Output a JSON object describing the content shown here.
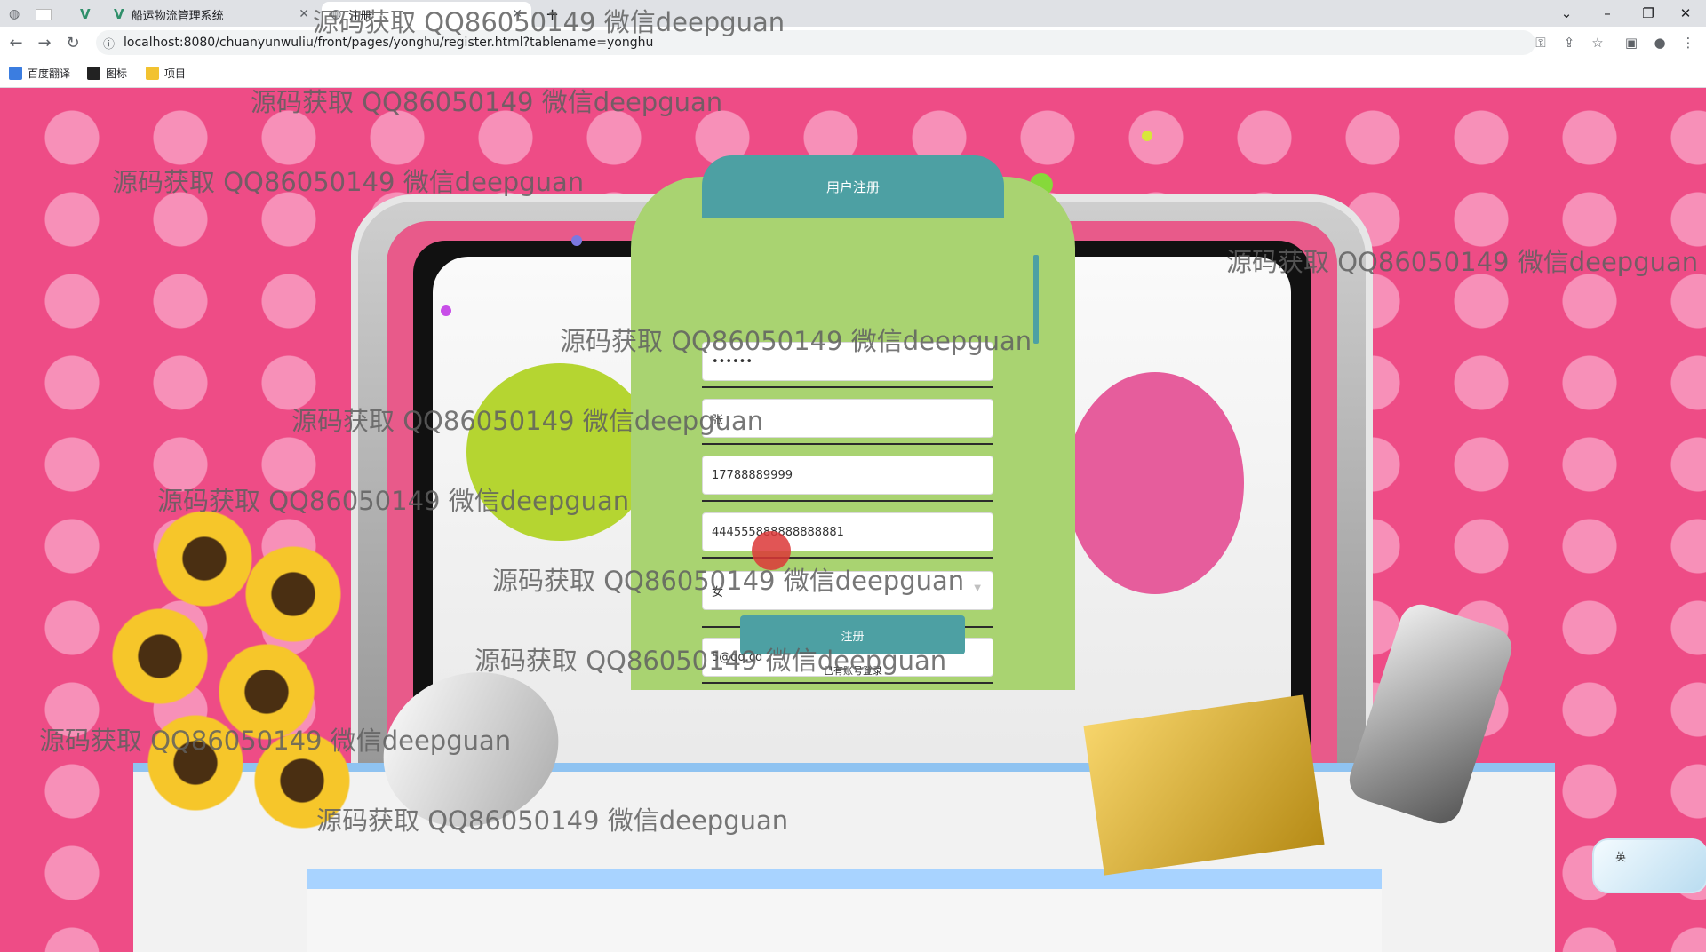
{
  "browser": {
    "tabs": [
      {
        "title": ""
      },
      {
        "title": ""
      },
      {
        "title": ""
      },
      {
        "title": "船运物流管理系统"
      },
      {
        "title": "注册"
      }
    ],
    "new_tab": "+",
    "window_controls": {
      "list": "⌄",
      "minimize": "–",
      "restore": "❐",
      "close": "✕"
    },
    "nav": {
      "back": "←",
      "forward": "→",
      "reload": "↻"
    },
    "address": {
      "info": "ⓘ",
      "url": "localhost:8080/chuanyunwuliu/front/pages/yonghu/register.html?tablename=yonghu"
    },
    "toolbar_icons": {
      "key": "⚿",
      "share": "⇪",
      "star": "☆",
      "sidebar": "▣",
      "profile": "●",
      "menu": "⋮"
    },
    "bookmarks": [
      {
        "label": "百度翻译",
        "color": "#3b7de0"
      },
      {
        "label": "图标",
        "color": "#222222"
      },
      {
        "label": "项目",
        "color": "#f2c230"
      }
    ]
  },
  "register": {
    "title": "用户注册",
    "fields": [
      {
        "name": "password",
        "value": "••••••"
      },
      {
        "name": "name",
        "value": "张"
      },
      {
        "name": "phone",
        "value": "17788889999"
      },
      {
        "name": "id_card",
        "value": "444555888888888881"
      },
      {
        "name": "gender",
        "value": "女"
      },
      {
        "name": "email",
        "value": "5@qq.cd"
      }
    ],
    "submit_label": "注册",
    "login_link": "已有账号登录"
  },
  "ime": {
    "label": "英"
  },
  "watermark": {
    "text": "源码获取 QQ86050149 微信deepguan"
  },
  "colors": {
    "page_pink": "#ee4c86",
    "card_green": "#a9d371",
    "accent_teal": "#4da0a3"
  }
}
